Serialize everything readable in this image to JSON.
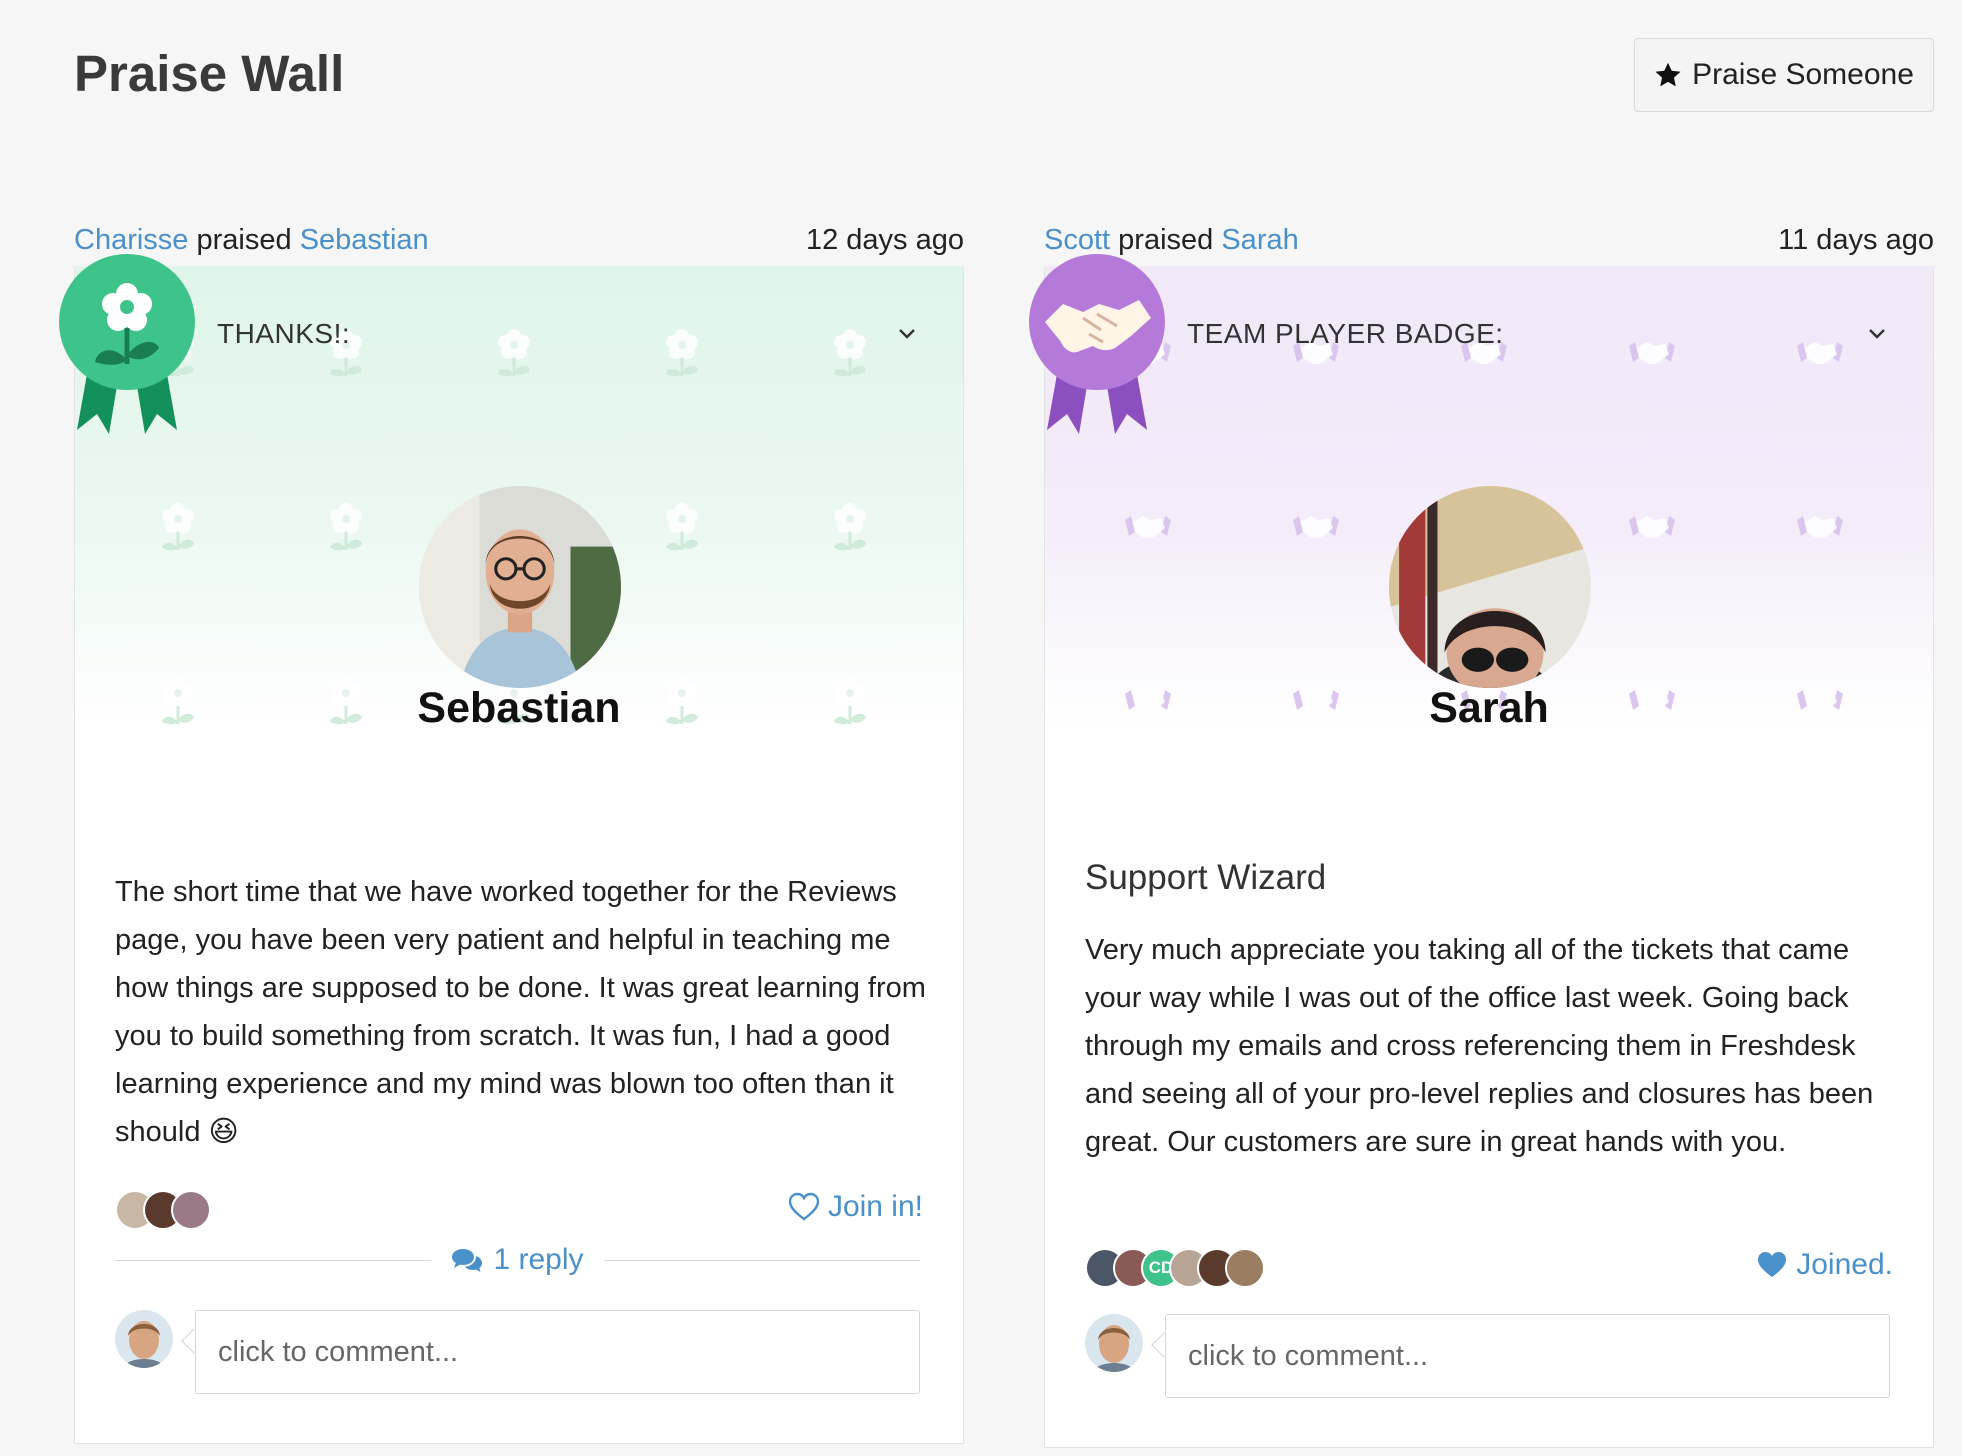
{
  "page": {
    "title": "Praise Wall"
  },
  "header": {
    "praise_button_label": "Praise Someone"
  },
  "icons": {
    "star": "star-icon",
    "heart": "heart-icon",
    "comments": "comments-icon",
    "chevron": "chevron-down-icon"
  },
  "colors": {
    "link": "#4a90c9",
    "green_badge": "#3ec48a",
    "purple_badge": "#b57ad9"
  },
  "posts": [
    {
      "giver": "Charisse",
      "verb": "praised",
      "recipient": "Sebastian",
      "time": "12 days ago",
      "badge_label": "THANKS!:",
      "recipient_name": "Sebastian",
      "subtitle": "",
      "message": "The short time that we have worked together for the Reviews page, you have been very patient and helpful in teaching me how things are supposed to be done. It was great learning from you to build something from scratch. It was fun, I had a good learning experience and my mind was blown too often than it should 😆",
      "join_label": "Join in!",
      "reply_label": "1 reply",
      "comment_placeholder": "click to comment..."
    },
    {
      "giver": "Scott",
      "verb": "praised",
      "recipient": "Sarah",
      "time": "11 days ago",
      "badge_label": "TEAM PLAYER BADGE:",
      "recipient_name": "Sarah",
      "subtitle": "Support Wizard",
      "message": "Very much appreciate you taking all of the tickets that came your way while I was out of the office last week. Going back through my emails and cross referencing them in Freshdesk and seeing all of your pro-level replies and closures has been great. Our customers are sure in great hands with you.",
      "joiner_initials": "CD",
      "join_label": "Joined.",
      "comment_placeholder": "click to comment..."
    }
  ]
}
